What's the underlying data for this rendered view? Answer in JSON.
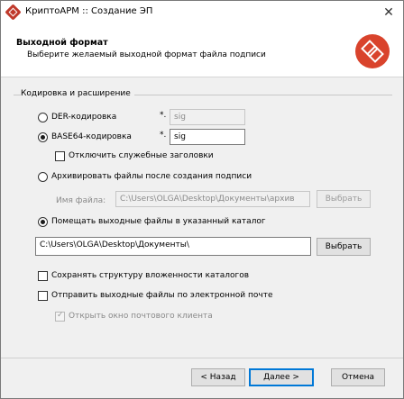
{
  "window": {
    "title": "КриптоАРМ :: Создание ЭП",
    "close": "✕"
  },
  "header": {
    "title": "Выходной формат",
    "subtitle": "Выберите желаемый выходной формат файла подписи"
  },
  "group": {
    "label": "Кодировка и расширение"
  },
  "der": {
    "label": "DER-кодировка",
    "ext_prefix": "*.",
    "ext_value": "sig"
  },
  "base64": {
    "label": "BASE64-кодировка",
    "ext_prefix": "*.",
    "ext_value": "sig"
  },
  "disable_headers": {
    "label": "Отключить служебные заголовки"
  },
  "archive": {
    "label": "Архивировать файлы после создания подписи",
    "file_label": "Имя файла:",
    "file_value": "C:\\Users\\OLGA\\Desktop\\Документы\\архив",
    "browse": "Выбрать"
  },
  "output_dir": {
    "label": "Помещать выходные файлы в указанный каталог",
    "path": "C:\\Users\\OLGA\\Desktop\\Документы\\",
    "browse": "Выбрать"
  },
  "keep_structure": {
    "label": "Сохранять структуру вложенности каталогов"
  },
  "send_email": {
    "label": "Отправить выходные файлы по электронной почте"
  },
  "open_mail": {
    "label": "Открыть окно почтового клиента"
  },
  "footer": {
    "back": "< Назад",
    "next": "Далее >",
    "cancel": "Отмена"
  },
  "colors": {
    "accent": "#0078d7",
    "logo": "#d9432c"
  }
}
